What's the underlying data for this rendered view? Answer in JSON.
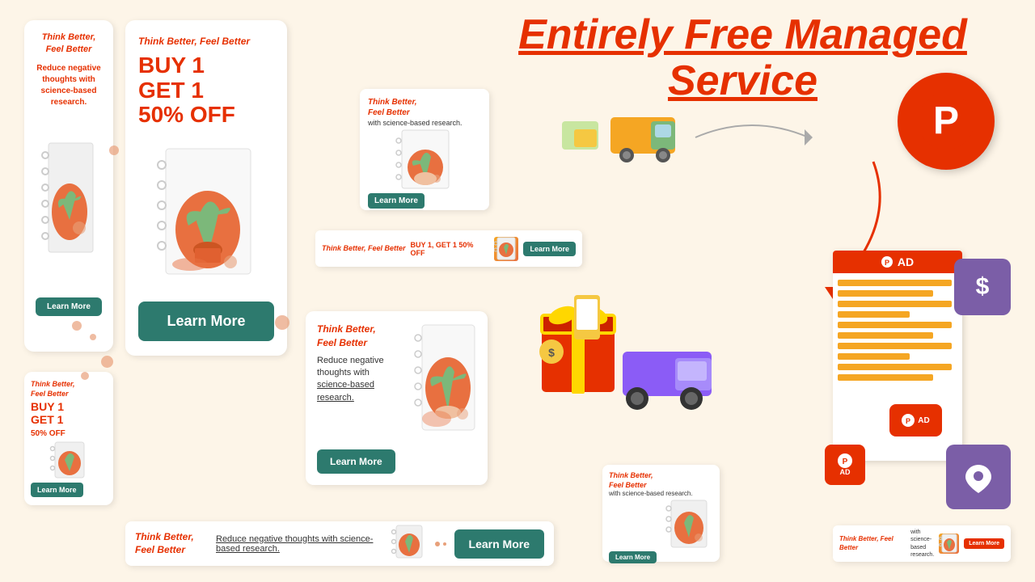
{
  "page": {
    "bg_color": "#fdf5e8",
    "title": "Entirely Free Managed Service"
  },
  "cards": {
    "tall_left": {
      "brand": "Think Better, Feel Better",
      "desc": "Reduce negative thoughts with science-based research.",
      "learn_btn": "Learn More"
    },
    "tall_right": {
      "brand": "Think Better, Feel Better",
      "sale_line1": "BUY 1",
      "sale_line2": "GET 1",
      "sale_line3": "50% OFF",
      "learn_btn": "Learn More"
    },
    "small_notebook": {
      "brand_line1": "Think Better,",
      "brand_line2": "Feel Better",
      "desc": "with science-based research.",
      "learn_btn": "Learn More"
    },
    "banner": {
      "brand": "Think Better, Feel Better",
      "sale": "BUY 1, GET 1 50% OFF",
      "learn_btn": "Learn More"
    },
    "medium": {
      "brand_line1": "Think Better,",
      "brand_line2": "Feel Better",
      "desc_line1": "Reduce negative",
      "desc_line2": "thoughts with",
      "desc_line3": "science-based",
      "desc_line4": "research.",
      "learn_btn": "Learn More"
    },
    "bottom_small": {
      "brand_line1": "Think Better,",
      "brand_line2": "Feel Better",
      "desc": "with science-based research.",
      "learn_btn": "Learn More"
    },
    "bottom_banner": {
      "brand_line1": "Think Better,",
      "brand_line2": "Feel Better",
      "desc": "Reduce negative thoughts with science-based research.",
      "learn_btn": "Learn More"
    },
    "bottom_right": {
      "brand": "Think Better, Feel Better",
      "desc": "with science-based research.",
      "learn_btn": "Learn More"
    },
    "bottom_left_small": {
      "brand_line1": "Think Better,",
      "brand_line2": "Feel Better",
      "sale_line1": "BUY 1",
      "sale_line2": "GET 1",
      "sale_line3": "50% OFF",
      "learn_btn": "Learn More"
    }
  },
  "icons": {
    "pinterest": "P",
    "dollar": "$",
    "location": "📍",
    "ad_label": "AD",
    "truck": "🚚",
    "gift": "🎁"
  },
  "colors": {
    "orange_red": "#e63000",
    "teal": "#2d7a6e",
    "purple": "#7b5ea7",
    "bg": "#fdf5e8",
    "notebook_orange": "#e87040",
    "notebook_green": "#7cb87a"
  }
}
